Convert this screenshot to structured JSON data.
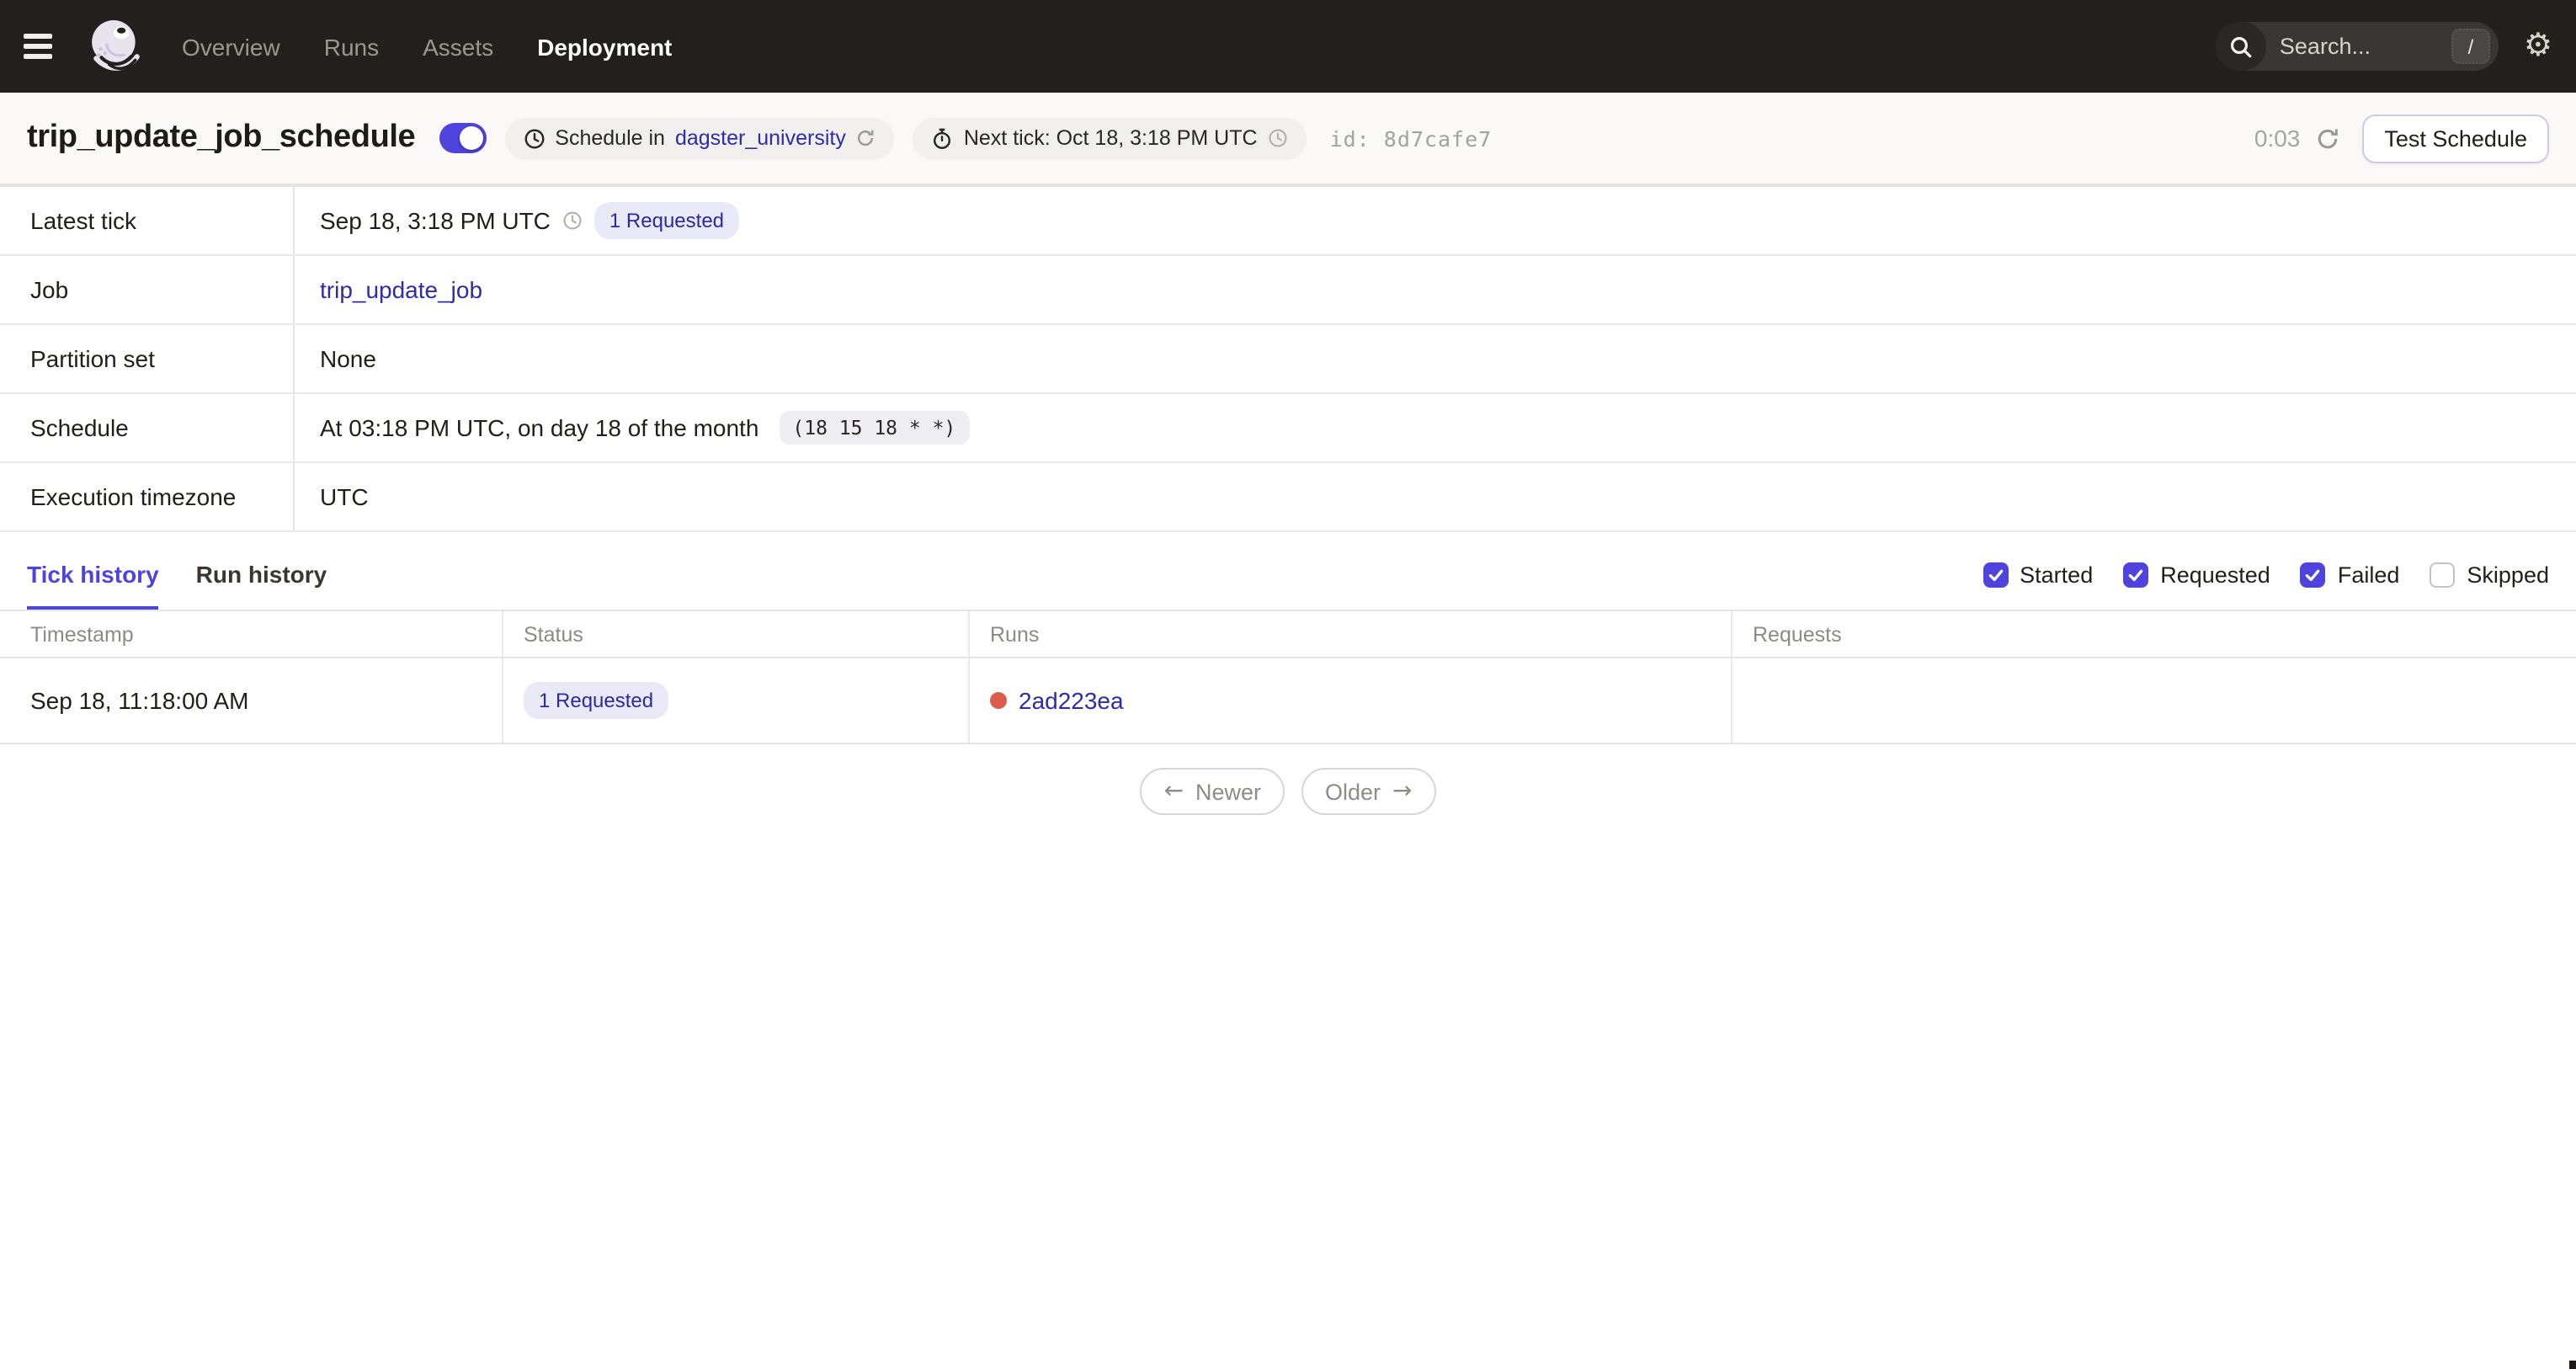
{
  "topbar": {
    "nav": [
      {
        "label": "Overview",
        "active": false
      },
      {
        "label": "Runs",
        "active": false
      },
      {
        "label": "Assets",
        "active": false
      },
      {
        "label": "Deployment",
        "active": true
      }
    ],
    "search": {
      "placeholder": "Search...",
      "shortcut": "/"
    }
  },
  "titlebar": {
    "title": "trip_update_job_schedule",
    "toggle_on": true,
    "schedule_pill": {
      "prefix": "Schedule in",
      "repo": "dagster_university"
    },
    "next_tick": "Next tick: Oct 18, 3:18 PM UTC",
    "id_label": "id:",
    "id_value": "8d7cafe7",
    "countdown": "0:03",
    "test_button": "Test Schedule"
  },
  "details": {
    "rows": [
      {
        "label": "Latest tick",
        "value": "Sep 18, 3:18 PM UTC",
        "badge": "1 Requested"
      },
      {
        "label": "Job",
        "link": "trip_update_job"
      },
      {
        "label": "Partition set",
        "value": "None"
      },
      {
        "label": "Schedule",
        "value": "At 03:18 PM UTC, on day 18 of the month",
        "cron": "(18 15 18 * *)"
      },
      {
        "label": "Execution timezone",
        "value": "UTC"
      }
    ]
  },
  "history": {
    "tabs": [
      {
        "label": "Tick history",
        "active": true
      },
      {
        "label": "Run history",
        "active": false
      }
    ],
    "filters": [
      {
        "label": "Started",
        "checked": true
      },
      {
        "label": "Requested",
        "checked": true
      },
      {
        "label": "Failed",
        "checked": true
      },
      {
        "label": "Skipped",
        "checked": false
      }
    ]
  },
  "tick_table": {
    "columns": [
      "Timestamp",
      "Status",
      "Runs",
      "Requests"
    ],
    "rows": [
      {
        "timestamp": "Sep 18, 11:18:00 AM",
        "status_badge": "1 Requested",
        "run_id": "2ad223ea",
        "run_status": "failed"
      }
    ]
  },
  "pagination": {
    "newer": "Newer",
    "older": "Older"
  },
  "colors": {
    "accent": "#4f43dd",
    "link": "#2e2ca8",
    "topbar_bg": "#231f1d",
    "titlebar_bg": "#faf9f7",
    "badge_bg": "#eae9f8",
    "badge_text": "#2b2b9e",
    "failed_dot": "#db5c4f"
  }
}
